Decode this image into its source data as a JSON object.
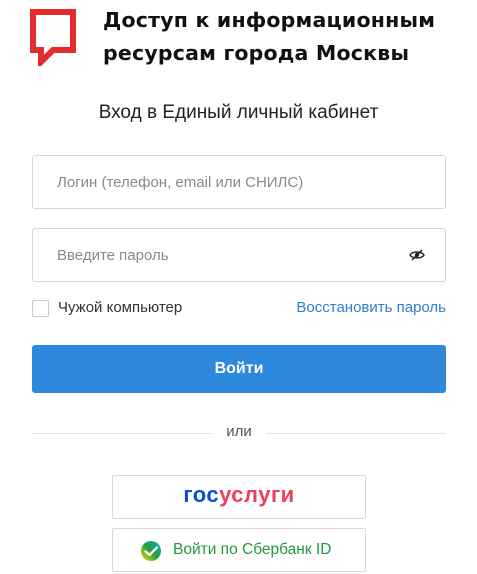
{
  "header": {
    "title_line1": "Доступ к информационным",
    "title_line2": "ресурсам города Москвы",
    "logo_color": "#e32d2d"
  },
  "form": {
    "subtitle": "Вход в Единый личный кабинет",
    "login_placeholder": "Логин (телефон, email или СНИЛС)",
    "login_value": "",
    "password_placeholder": "Введите пароль",
    "password_value": "",
    "foreign_computer_label": "Чужой компьютер",
    "foreign_computer_checked": false,
    "restore_password_link": "Восстановить пароль",
    "submit_label": "Войти",
    "accent_color": "#2e88dc",
    "link_color": "#2d7fd1"
  },
  "alternatives": {
    "divider_text": "или",
    "gosuslugi_part1": "гос",
    "gosuslugi_part2": "услуги",
    "sber_label": "Войти по Сбербанк ID",
    "sber_color": "#1f9a3e"
  },
  "icons": {
    "logo": "mos-speech-bubble-logo",
    "password_toggle": "eye-slash-icon",
    "sber": "sberbank-logo-icon"
  }
}
